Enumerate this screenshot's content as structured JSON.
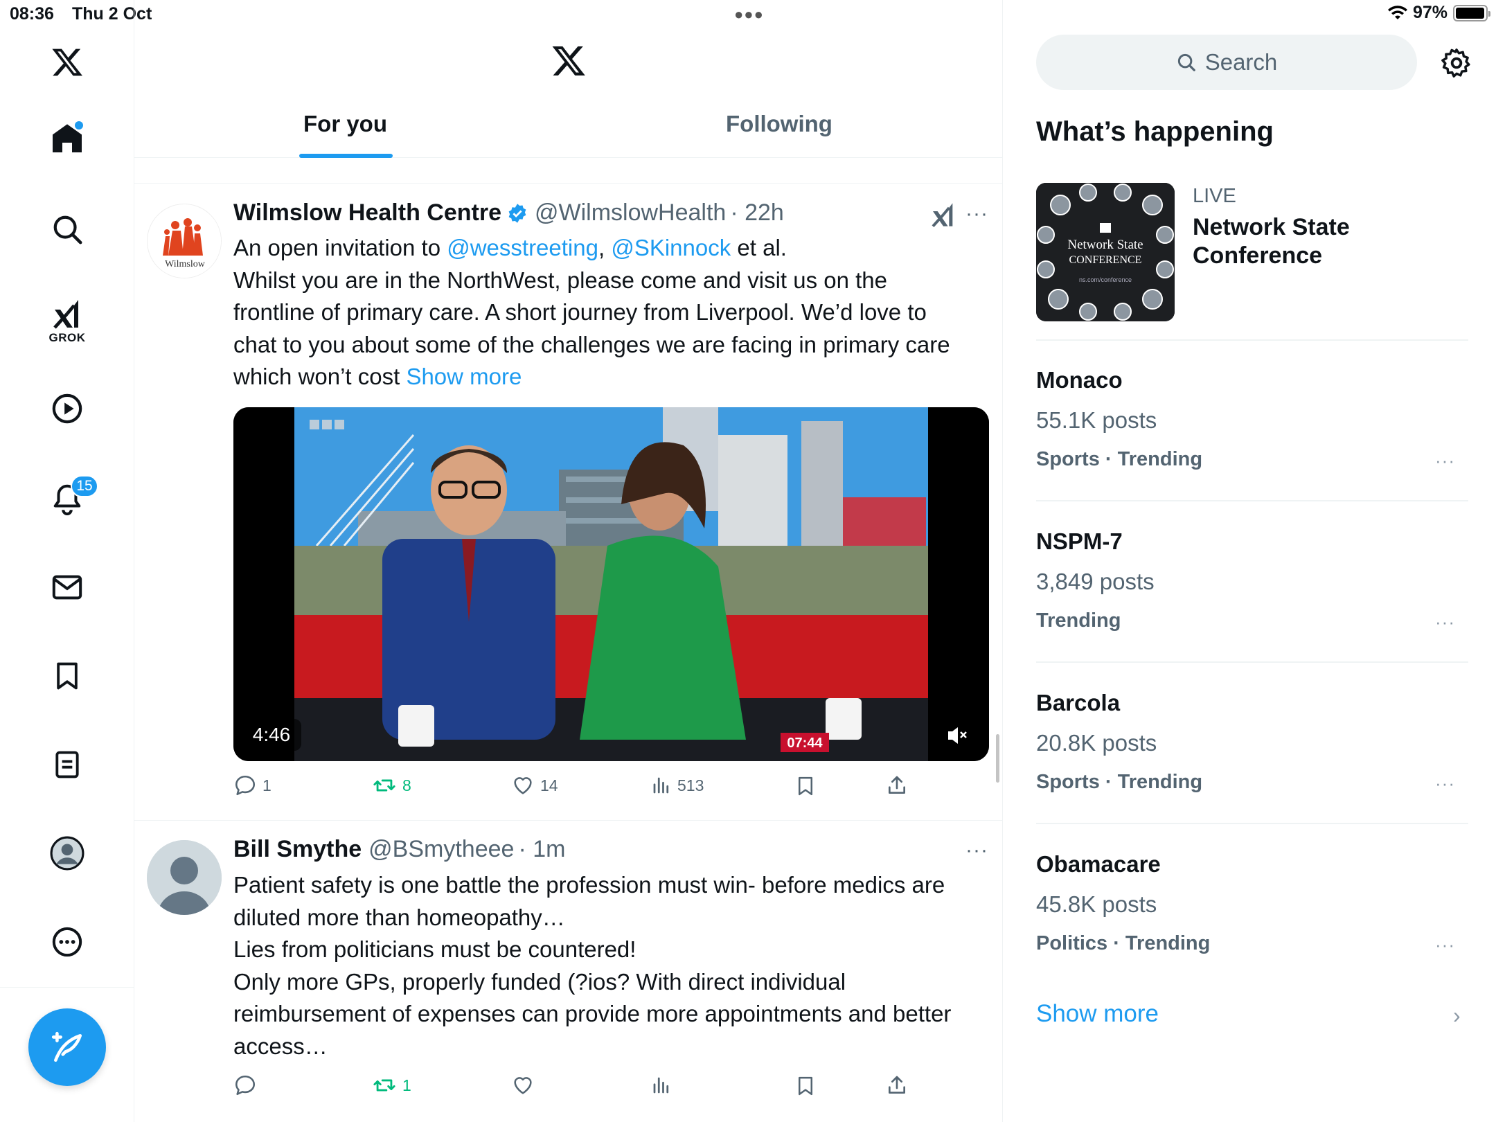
{
  "status": {
    "time": "08:36",
    "date": "Thu 2 Oct",
    "battery": "97%",
    "battery_level": 0.97
  },
  "nav": {
    "grok_label": "GROK",
    "notifications_badge": "15"
  },
  "tabs": [
    {
      "label": "For you",
      "active": true
    },
    {
      "label": "Following",
      "active": false
    }
  ],
  "tweets": [
    {
      "name": "Wilmslow Health Centre",
      "handle": "@WilmslowHealth",
      "time": "· 22h",
      "verified": true,
      "avatar_text": "Wilmslow",
      "text_prefix": "An open invitation to ",
      "mention1": "@wesstreeting",
      "comma": ", ",
      "mention2": "@SKinnock",
      "text_suffix": " et al.",
      "body": "Whilst you are in the NorthWest, please come and visit us on the\nfrontline of primary care. A short journey from Liverpool. We’d love to\nchat to you about some of the challenges we are facing in primary care\nwhich won’t cost ",
      "show_more": "Show more",
      "video": {
        "duration": "4:46",
        "clock": "07:44"
      },
      "actions": {
        "replies": "1",
        "reposts": "8",
        "likes": "14",
        "views": "513"
      }
    },
    {
      "name": "Bill Smythe",
      "handle": "@BSmytheee",
      "time": "· 1m",
      "body": "Patient safety is one battle the profession must win- before medics are\ndiluted more than homeopathy…\nLies from politicians must be countered!\nOnly more GPs, properly funded (?ios? With direct individual\nreimbursement of expenses can provide more appointments and better\naccess…",
      "actions": {
        "reposts": "1"
      }
    }
  ],
  "right": {
    "search_placeholder": "Search",
    "whats_happening": "What’s happening",
    "live": {
      "label": "LIVE",
      "title": "Network State Conference",
      "thumb_line1": "Network State",
      "thumb_line2": "CONFERENCE",
      "thumb_url": "ns.com/conference"
    },
    "trends": [
      {
        "name": "Monaco",
        "posts": "55.1K posts",
        "category": "Sports · Trending"
      },
      {
        "name": "NSPM-7",
        "posts": "3,849 posts",
        "category": "Trending"
      },
      {
        "name": "Barcola",
        "posts": "20.8K posts",
        "category": "Sports · Trending"
      },
      {
        "name": "Obamacare",
        "posts": "45.8K posts",
        "category": "Politics · Trending"
      }
    ],
    "show_more": "Show more"
  },
  "colors": {
    "accent": "#1d9bf0",
    "repost": "#00ba7c",
    "muted": "#536471"
  }
}
